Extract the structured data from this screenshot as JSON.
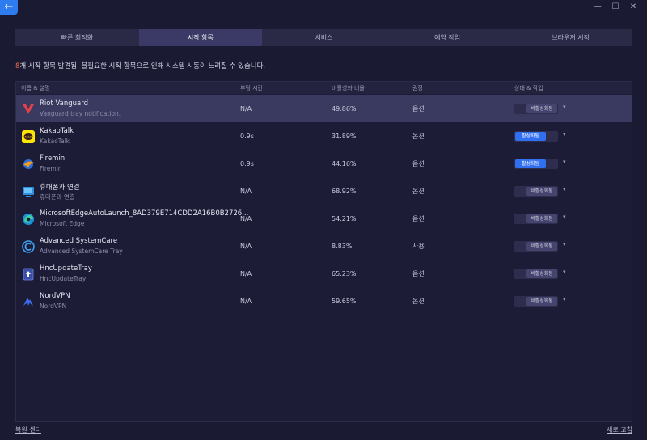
{
  "window": {
    "back_label": "←",
    "minimize": "—",
    "maximize": "☐",
    "close": "✕"
  },
  "tabs": [
    {
      "label": "빠른 최적화"
    },
    {
      "label": "시작 항목"
    },
    {
      "label": "서비스"
    },
    {
      "label": "예약 작업"
    },
    {
      "label": "브라우저 시작"
    }
  ],
  "info": {
    "count": "8",
    "text": "개 시작 항목 발견됨. 불필요한 시작 항목으로 인해 시스템 시동이 느려질 수 있습니다."
  },
  "columns": {
    "name": "이름 & 설명",
    "boot": "부팅 시간",
    "rate": "비활성화 비율",
    "rec": "권장",
    "status": "상태 & 작업"
  },
  "rows": [
    {
      "name": "Riot Vanguard",
      "sub": "Vanguard tray notification.",
      "boot": "N/A",
      "rate": "49.86%",
      "rec": "옵션",
      "status": "비활성화됨",
      "icon": "riot-vanguard-icon"
    },
    {
      "name": "KakaoTalk",
      "sub": "KakaoTalk",
      "boot": "0.9s",
      "rate": "31.89%",
      "rec": "옵션",
      "status": "활성화됨",
      "icon": "kakaotalk-icon"
    },
    {
      "name": "Firemin",
      "sub": "Firemin",
      "boot": "0.9s",
      "rate": "44.16%",
      "rec": "옵션",
      "status": "활성화됨",
      "icon": "firemin-icon"
    },
    {
      "name": "휴대폰과 연결",
      "sub": "휴대폰과 연결",
      "boot": "N/A",
      "rate": "68.92%",
      "rec": "옵션",
      "status": "비활성화됨",
      "icon": "phone-link-icon"
    },
    {
      "name": "MicrosoftEdgeAutoLaunch_8AD379E714CDD2A16B0B2726...",
      "sub": "Microsoft Edge",
      "boot": "N/A",
      "rate": "54.21%",
      "rec": "옵션",
      "status": "비활성화됨",
      "icon": "edge-icon"
    },
    {
      "name": "Advanced SystemCare",
      "sub": "Advanced SystemCare Tray",
      "boot": "N/A",
      "rate": "8.83%",
      "rec": "사용",
      "status": "비활성화됨",
      "icon": "systemcare-icon"
    },
    {
      "name": "HncUpdateTray",
      "sub": "HncUpdateTray",
      "boot": "N/A",
      "rate": "65.23%",
      "rec": "옵션",
      "status": "비활성화됨",
      "icon": "hnc-update-icon"
    },
    {
      "name": "NordVPN",
      "sub": "NordVPN",
      "boot": "N/A",
      "rate": "59.65%",
      "rec": "옵션",
      "status": "비활성화됨",
      "icon": "nordvpn-icon"
    }
  ],
  "footer": {
    "left": "복원 센터",
    "right": "새로 고침"
  },
  "colors": {
    "background": "#1b1a33",
    "accent": "#2f6ff0",
    "warning": "#ff6a45"
  }
}
